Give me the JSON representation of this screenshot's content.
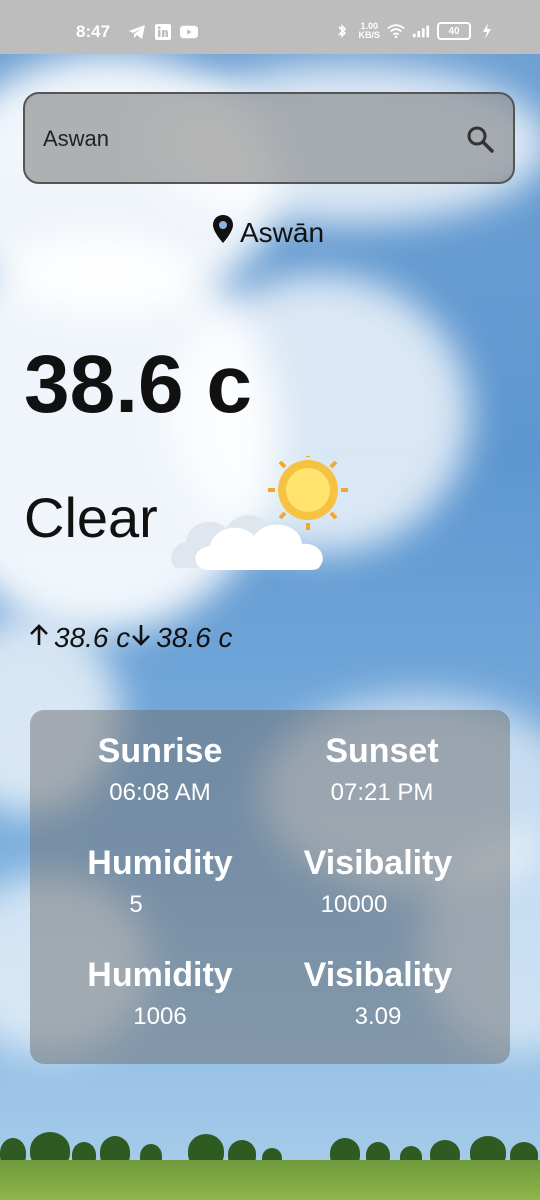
{
  "status_bar": {
    "time": "8:47",
    "network_speed_top": "1.00",
    "network_speed_unit": "KB/S",
    "battery": "40"
  },
  "search": {
    "value": "Aswan"
  },
  "location": {
    "name": "Aswān"
  },
  "weather": {
    "temperature": "38.6 c",
    "condition": "Clear",
    "max": "38.6 c",
    "min": "38.6 c"
  },
  "details": [
    {
      "label": "Sunrise",
      "value": "06:08 AM"
    },
    {
      "label": "Sunset",
      "value": "07:21 PM"
    },
    {
      "label": "Humidity",
      "value": "5"
    },
    {
      "label": "Visibality",
      "value": "10000"
    },
    {
      "label": "Humidity",
      "value": "1006"
    },
    {
      "label": "Visibality",
      "value": "3.09"
    }
  ],
  "icons": {
    "search": "search-icon",
    "location": "location-pin-icon",
    "weather": "sun-behind-cloud-icon",
    "arrow_up": "arrow-up-icon",
    "arrow_down": "arrow-down-icon"
  }
}
